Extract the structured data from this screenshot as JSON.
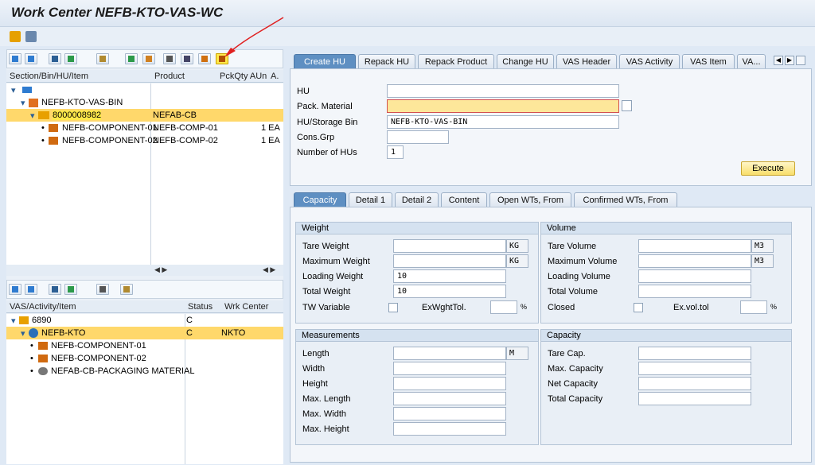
{
  "window": {
    "title": "Work Center NEFB-KTO-VAS-WC"
  },
  "hu_tree": {
    "columns": [
      "Section/Bin/HU/Item",
      "Product",
      "PckQty AUn",
      "A."
    ],
    "rows": [
      {
        "label": "",
        "product": "",
        "qty": ""
      },
      {
        "label": "NEFB-KTO-VAS-BIN",
        "product": "",
        "qty": ""
      },
      {
        "label": "8000008982",
        "product": "NEFAB-CB",
        "qty": ""
      },
      {
        "label": "NEFB-COMPONENT-01",
        "product": "NEFB-COMP-01",
        "qty": "1 EA"
      },
      {
        "label": "NEFB-COMPONENT-02",
        "product": "NEFB-COMP-02",
        "qty": "1 EA"
      }
    ]
  },
  "vas_tree": {
    "columns": [
      "VAS/Activity/Item",
      "Status",
      "Wrk Center"
    ],
    "rows": [
      {
        "label": "6890",
        "status": "C",
        "center": ""
      },
      {
        "label": "NEFB-KTO",
        "status": "C",
        "center": "NKTO"
      },
      {
        "label": "NEFB-COMPONENT-01",
        "status": "",
        "center": ""
      },
      {
        "label": "NEFB-COMPONENT-02",
        "status": "",
        "center": ""
      },
      {
        "label": "NEFAB-CB-PACKAGING MATERIAL",
        "status": "",
        "center": ""
      }
    ]
  },
  "top_tabs": [
    "Create HU",
    "Repack HU",
    "Repack Product",
    "Change HU",
    "VAS Header",
    "VAS Activity",
    "VAS Item",
    "VA..."
  ],
  "create_hu": {
    "hu_label": "HU",
    "hu_value": "",
    "pack_label": "Pack. Material",
    "pack_value": "",
    "bin_label": "HU/Storage Bin",
    "bin_value": "NEFB-KTO-VAS-BIN",
    "cons_label": "Cons.Grp",
    "cons_value": "",
    "num_label": "Number of HUs",
    "num_value": "1",
    "execute": "Execute"
  },
  "detail_tabs": [
    "Capacity",
    "Detail 1",
    "Detail 2",
    "Content",
    "Open WTs, From",
    "Confirmed WTs, From"
  ],
  "weight": {
    "title": "Weight",
    "tare": "Tare Weight",
    "tare_unit": "KG",
    "max": "Maximum Weight",
    "max_unit": "KG",
    "loading": "Loading Weight",
    "loading_val": "10",
    "total": "Total Weight",
    "total_val": "10",
    "twvar": "TW Variable",
    "exw": "ExWghtTol.",
    "pct": "%"
  },
  "volume": {
    "title": "Volume",
    "tare": "Tare Volume",
    "tare_unit": "M3",
    "max": "Maximum Volume",
    "max_unit": "M3",
    "loading": "Loading Volume",
    "total": "Total Volume",
    "closed": "Closed",
    "exv": "Ex.vol.tol",
    "pct": "%"
  },
  "measurements": {
    "title": "Measurements",
    "length": "Length",
    "length_unit": "M",
    "width": "Width",
    "height": "Height",
    "maxlength": "Max. Length",
    "maxwidth": "Max. Width",
    "maxheight": "Max. Height"
  },
  "capacity": {
    "title": "Capacity",
    "tare": "Tare Cap.",
    "max": "Max. Capacity",
    "net": "Net Capacity",
    "total": "Total Capacity"
  }
}
